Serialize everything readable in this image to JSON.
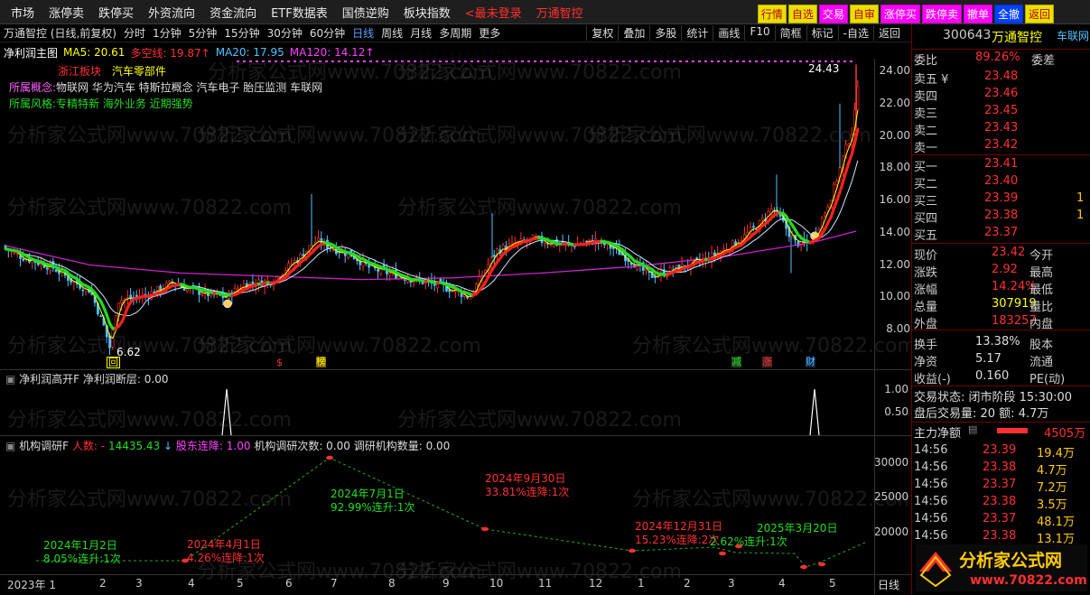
{
  "menu": [
    "市场",
    "涨停卖",
    "跌停买",
    "外资流向",
    "资金流向",
    "ETF数据表",
    "国债逆购",
    "板块指数"
  ],
  "login_text": "<最未登录",
  "stock_label": "万通智控",
  "right_buttons": [
    "行情",
    "自选",
    "交易",
    "自审",
    "涨停买",
    "跌停卖",
    "撤单",
    "全撤",
    "返回"
  ],
  "periods": [
    "分时",
    "1分钟",
    "5分钟",
    "15分钟",
    "30分钟",
    "60分钟",
    "日线",
    "周线",
    "月线",
    "多周期",
    "更多"
  ],
  "selected_period": "日线",
  "tools": [
    "复权",
    "叠加",
    "多股",
    "统计",
    "画线",
    "F10",
    "简框",
    "标记",
    "-自选",
    "返回"
  ],
  "chart_title": "万通智控 (日线,前复权)",
  "indicator_name": "净利润主图",
  "ma": {
    "ma5": "MA5: 20.61",
    "dkx": "多空线: 19.87",
    "ma20": "MA20: 17.95",
    "ma120": "MA120: 14.12",
    "up": "↑"
  },
  "sector": "浙江板块",
  "sector2": "汽车零部件",
  "concepts_label": "所属概念:",
  "concepts": "物联网 华为汽车 特斯拉概念 汽车电子 胎压监测 车联网",
  "styles_label": "所属风格:",
  "styles": "专精特新 海外业务 近期强势",
  "high_label": "24.43",
  "low_label": "6.62",
  "events": [
    "回",
    "$",
    "榜",
    "减",
    "涨",
    "财"
  ],
  "sub1": {
    "name": "净利润高开F",
    "field": "净利润断层: 0.00",
    "ticks": [
      "1.00",
      "0.50"
    ]
  },
  "sub2": {
    "name": "机构调研F",
    "people": "人数: -",
    "value": "14435.43",
    "arrow": "↓",
    "holders": "股东连降: 1.00",
    "times": "机构调研次数: 0.00",
    "count": "调研机构数量: 0.00",
    "ticks": [
      "30000",
      "25000",
      "20000"
    ]
  },
  "price_ticks": [
    "24.00",
    "22.00",
    "20.00",
    "18.00",
    "16.00",
    "14.00",
    "12.00",
    "10.00",
    "8.00"
  ],
  "months": [
    "2023年 1",
    "2",
    "3",
    "4",
    "5",
    "6",
    "7",
    "8",
    "9",
    "10",
    "11",
    "12",
    "1",
    "2",
    "3",
    "4",
    "5"
  ],
  "period_axis": "日线",
  "survey_notes": [
    {
      "date": "2024年1月2日",
      "note": "8.05%连升:1次",
      "color": "#22dd22"
    },
    {
      "date": "2024年4月1日",
      "note": "4.26%连降:1次",
      "color": "#ff3030"
    },
    {
      "date": "2024年7月1日",
      "note": "92.99%连升:1次",
      "color": "#22dd22"
    },
    {
      "date": "2024年9月30日",
      "note": "33.81%连降:1次",
      "color": "#ff3030"
    },
    {
      "date": "2024年12月31日",
      "note": "15.23%连降:2次",
      "color": "#ff3030"
    },
    {
      "date": "2025年3月20日",
      "note": "2.62%连升:1次",
      "color": "#22dd22"
    }
  ],
  "quote": {
    "code": "300643",
    "name": "万通智控",
    "board": "车联网",
    "wb_label": "委比",
    "wb_val": "89.26%",
    "wc_label": "委差",
    "asks": [
      [
        "卖五 ¥",
        "23.48"
      ],
      [
        "卖四",
        "23.46"
      ],
      [
        "卖三",
        "23.45"
      ],
      [
        "卖二",
        "23.43"
      ],
      [
        "卖一",
        "23.42"
      ]
    ],
    "bids": [
      [
        "买一",
        "23.41",
        ""
      ],
      [
        "买二",
        "23.40",
        ""
      ],
      [
        "买三",
        "23.39",
        "1"
      ],
      [
        "买四",
        "23.38",
        "1"
      ],
      [
        "买五",
        "23.37",
        ""
      ]
    ],
    "stats": [
      [
        "现价",
        "23.42",
        "今开"
      ],
      [
        "涨跌",
        "2.92",
        "最高"
      ],
      [
        "涨幅",
        "14.24%",
        "最低"
      ],
      [
        "总量",
        "307919",
        "量比"
      ],
      [
        "外盘",
        "183257",
        "内盘"
      ],
      [
        "换手",
        "13.38%",
        "股本"
      ],
      [
        "净资",
        "5.17",
        "流通"
      ],
      [
        "收益(-)",
        "0.160",
        "PE(动)"
      ]
    ],
    "status": "交易状态: 闭市阶段 15:30:00",
    "after": "盘后交易量: 20  额: 4.7万",
    "mainflow_label": "主力净额",
    "mainflow_val": "4505万",
    "ticks": [
      [
        "14:56",
        "23.39",
        "19.4万"
      ],
      [
        "14:56",
        "23.38",
        "4.7万"
      ],
      [
        "14:56",
        "23.37",
        "7.2万"
      ],
      [
        "14:56",
        "23.38",
        "3.5万"
      ],
      [
        "14:56",
        "23.37",
        "48.1万"
      ],
      [
        "14:56",
        "23.38",
        "13.1万"
      ]
    ]
  },
  "logo": {
    "text": "分析家公式网",
    "url": "www.70822.com"
  },
  "watermark": "分析家公式网www.70822.com",
  "colors": {
    "up": "#ff3030",
    "down": "#22dd22",
    "ma120": "#d020d0",
    "yellow": "#ffff00",
    "bg": "#000000"
  }
}
